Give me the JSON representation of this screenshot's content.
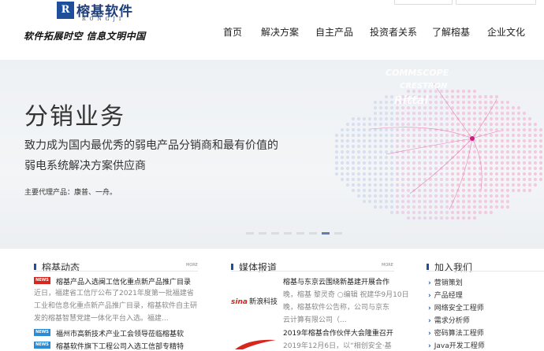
{
  "header": {
    "logo_mark": "R",
    "company_name": "榕基软件",
    "company_pinyin": "RONGJI",
    "slogan": "软件拓展时空 信息文明中国",
    "nav": [
      "首页",
      "解决方案",
      "自主产品",
      "投资者关系",
      "了解榕基",
      "企业文化"
    ]
  },
  "banner": {
    "title": "分销业务",
    "lines": [
      "致力成为国内最优秀的弱电产品分销商和最有价值的",
      "弱电系统解决方案供应商"
    ],
    "agents": "主要代理产品：康普、一舟。",
    "brands": [
      "COMMSCOPE",
      "CRESTRON",
      "Rittal"
    ],
    "slide_count": 8,
    "active_slide": 7
  },
  "news": {
    "title": "榕基动态",
    "more": "MORE",
    "items": [
      {
        "badge": "NEWS",
        "badge_color": "#d9251c",
        "title": "榕基产品入选闽工信化重点新产品推广目录",
        "summary": "近日，福建省工信厅公布了2021年度第一批福建省工业和信息化重点新产品推广目录，榕基软件自主研发的榕基智慧党建一体化平台入选。福建..."
      },
      {
        "badge": "NEWS",
        "badge_color": "#2a8bd6",
        "title": "福州市高新技术产业工会领导莅临榕基软"
      },
      {
        "badge": "NEWS",
        "badge_color": "#2a8bd6",
        "title": "榕基软件旗下工程公司入选工信部专精特"
      }
    ]
  },
  "media": {
    "title": "媒体报道",
    "more": "MORE",
    "items": [
      {
        "logo": "新浪科技",
        "headline": "榕基与东京云围绕新基建开展合作",
        "lines": [
          "晚，榕基 黎灵奇 ○编辑 祝建华9月10日",
          "晚，榕基软件公告称，公司与京东",
          "云计算有限公司（..."
        ]
      },
      {
        "logo": "",
        "headline": "2019年榕基合作伙伴大会隆重召开",
        "lines": [
          "2019年12月6日，以“相创安全·基"
        ]
      }
    ]
  },
  "jobs": {
    "title": "加入我们",
    "items": [
      "营销策划",
      "产品经理",
      "网络安全工程师",
      "需求分析师",
      "密码算法工程师",
      "Java开发工程师"
    ]
  },
  "colors": {
    "brand_blue": "#1f4e9a",
    "news_red": "#d9251c",
    "news_blue": "#2a8bd6"
  }
}
